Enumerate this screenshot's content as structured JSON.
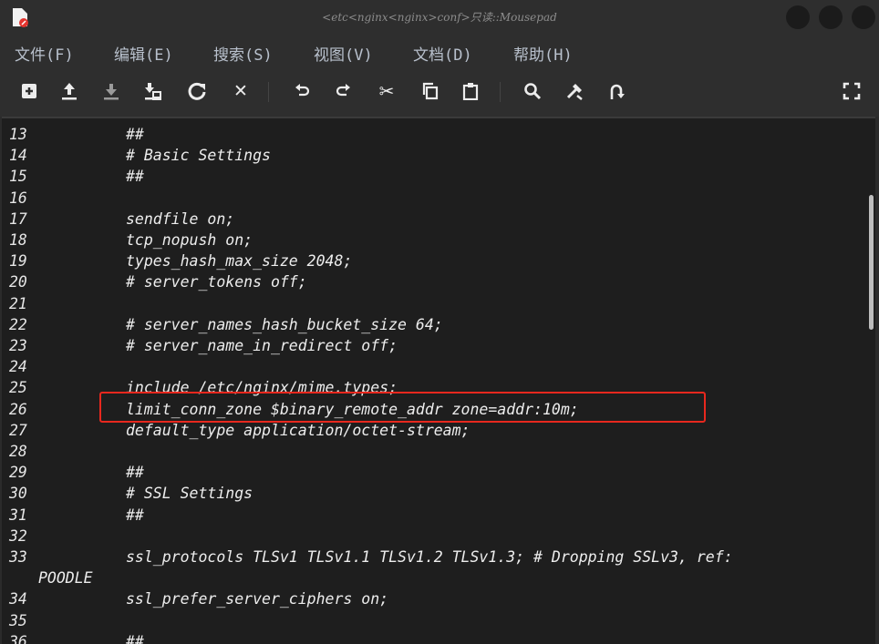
{
  "window": {
    "title": "<etc<nginx<nginx>conf>只读::Mousepad"
  },
  "menu": [
    "文件(F)",
    "编辑(E)",
    "搜索(S)",
    "视图(V)",
    "文档(D)",
    "帮助(H)"
  ],
  "toolbar": {
    "new": "new-file-icon",
    "open": "open-file-icon",
    "save": "save-file-icon",
    "save_as": "save-as-icon",
    "reload": "reload-icon",
    "close": "close-icon",
    "undo": "undo-icon",
    "redo": "redo-icon",
    "cut": "cut-icon",
    "copy": "copy-icon",
    "paste": "paste-icon",
    "find": "search-icon",
    "replace": "replace-icon",
    "goto": "goto-line-icon",
    "fullscreen": "fullscreen-icon"
  },
  "editor": {
    "lines": [
      {
        "n": "13",
        "text": "##"
      },
      {
        "n": "14",
        "text": "# Basic Settings"
      },
      {
        "n": "15",
        "text": "##"
      },
      {
        "n": "16",
        "text": ""
      },
      {
        "n": "17",
        "text": "sendfile on;"
      },
      {
        "n": "18",
        "text": "tcp_nopush on;"
      },
      {
        "n": "19",
        "text": "types_hash_max_size 2048;"
      },
      {
        "n": "20",
        "text": "# server_tokens off;"
      },
      {
        "n": "21",
        "text": ""
      },
      {
        "n": "22",
        "text": "# server_names_hash_bucket_size 64;"
      },
      {
        "n": "23",
        "text": "# server_name_in_redirect off;"
      },
      {
        "n": "24",
        "text": ""
      },
      {
        "n": "25",
        "text": "include /etc/nginx/mime.types;"
      },
      {
        "n": "26",
        "text": "limit_conn_zone $binary_remote_addr zone=addr:10m;"
      },
      {
        "n": "27",
        "text": "default_type application/octet-stream;"
      },
      {
        "n": "28",
        "text": ""
      },
      {
        "n": "29",
        "text": "##"
      },
      {
        "n": "30",
        "text": "# SSL Settings"
      },
      {
        "n": "31",
        "text": "##"
      },
      {
        "n": "32",
        "text": ""
      },
      {
        "n": "33",
        "text": "ssl_protocols TLSv1 TLSv1.1 TLSv1.2 TLSv1.3; # Dropping SSLv3, ref:"
      },
      {
        "n": "",
        "text": "POODLE"
      },
      {
        "n": "34",
        "text": "ssl_prefer_server_ciphers on;"
      },
      {
        "n": "35",
        "text": ""
      },
      {
        "n": "36",
        "text": "##"
      }
    ]
  },
  "colors": {
    "highlight_box": "#e8281e"
  }
}
